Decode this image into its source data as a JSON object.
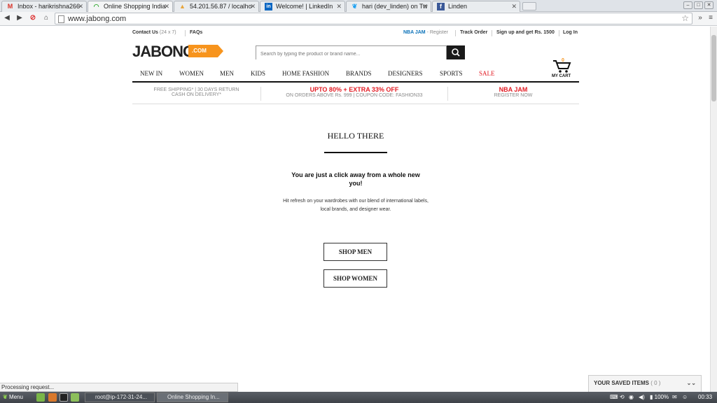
{
  "browser": {
    "tabs": [
      {
        "label": "Inbox - harikrishna266",
        "icon": "gmail-icon",
        "active": false
      },
      {
        "label": "Online Shopping India",
        "icon": "loading-icon",
        "active": true
      },
      {
        "label": "54.201.56.87 / localho",
        "icon": "phpmyadmin-icon",
        "active": false
      },
      {
        "label": "Welcome! | LinkedIn",
        "icon": "linkedin-icon",
        "active": false
      },
      {
        "label": "hari (dev_linden) on Tw",
        "icon": "twitter-icon",
        "active": false
      },
      {
        "label": "Linden",
        "icon": "facebook-icon",
        "active": false
      }
    ],
    "url": "www.jabong.com",
    "status_text": "Processing request..."
  },
  "topbar": {
    "contact_label": "Contact Us",
    "contact_hours": "(24 x 7)",
    "faqs": "FAQs",
    "nba_jam": "NBA JAM",
    "register": "- Register",
    "track_order": "Track Order",
    "signup": "Sign up and get Rs. 1500",
    "login": "Log In"
  },
  "header": {
    "logo_text": "JABONG",
    "logo_badge": ".COM",
    "search_placeholder": "Search by typing the product or brand name...",
    "cart_label": "MY CART",
    "cart_count": "0"
  },
  "nav": {
    "items": [
      "NEW IN",
      "WOMEN",
      "MEN",
      "KIDS",
      "HOME FASHION",
      "BRANDS",
      "DESIGNERS",
      "SPORTS",
      "SALE"
    ]
  },
  "promos": {
    "shipping_l1": "FREE SHIPPING* | 30 DAYS RETURN",
    "shipping_l2": "CASH ON DELIVERY*",
    "offer_l1": "UPTO 80% + EXTRA 33% OFF",
    "offer_l2a": "ON ORDERS ABOVE Rs. 999 |",
    "offer_l2b": "COUPON CODE: FASHION33",
    "nba_l1": "NBA JAM",
    "nba_l2": "REGISTER NOW"
  },
  "main": {
    "title": "HELLO THERE",
    "subtitle": "You are just a click away from a whole new you!",
    "body": "Hit refresh on your wardrobes with our blend of international labels, local brands, and designer wear.",
    "shop_men": "SHOP MEN",
    "shop_women": "SHOP WOMEN"
  },
  "saved": {
    "label": "YOUR SAVED ITEMS",
    "count": "( 0 )"
  },
  "taskbar": {
    "menu": "Menu",
    "task1": "root@ip-172-31-24...",
    "task2": "Online Shopping In...",
    "battery": "100%",
    "clock": "00:33"
  },
  "colors": {
    "accent_orange": "#f7941d",
    "sale_red": "#e31b23",
    "nba_blue": "#0b72b9"
  }
}
